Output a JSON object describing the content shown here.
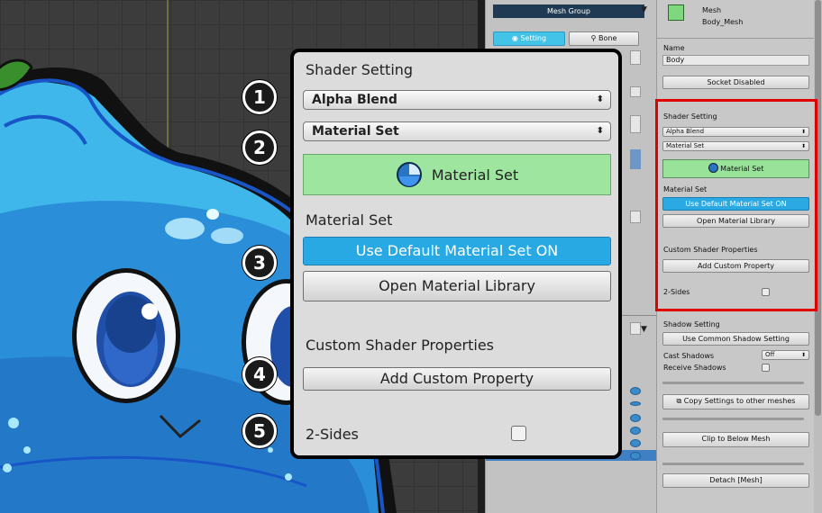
{
  "mid_panel": {
    "header": "Mesh Group",
    "tabs": [
      {
        "label": "Setting",
        "active": true
      },
      {
        "label": "Bone",
        "active": false
      }
    ]
  },
  "inspector": {
    "object_type": "Mesh",
    "object_name": "Body_Mesh",
    "name_label": "Name",
    "name_value": "Body",
    "socket_button": "Socket Disabled",
    "shader_setting_label": "Shader Setting",
    "blend_mode": "Alpha Blend",
    "material_select": "Material Set",
    "material_set_button": "Material Set",
    "material_set_label": "Material Set",
    "use_default_button": "Use Default Material Set ON",
    "open_library_button": "Open Material Library",
    "custom_props_label": "Custom Shader Properties",
    "add_custom_button": "Add Custom Property",
    "two_sides_label": "2-Sides",
    "shadow_setting_label": "Shadow Setting",
    "use_common_shadow_button": "Use Common Shadow Setting",
    "cast_shadows_label": "Cast Shadows",
    "cast_shadows_value": "Off",
    "receive_shadows_label": "Receive Shadows",
    "copy_settings_button": "Copy Settings to other meshes",
    "clip_button": "Clip to Below Mesh",
    "detach_button": "Detach [Mesh]"
  },
  "zoom": {
    "shader_setting_label": "Shader Setting",
    "blend_mode": "Alpha Blend",
    "material_select": "Material Set",
    "material_set_button": "Material Set",
    "material_set_label": "Material Set",
    "use_default_button": "Use Default Material Set ON",
    "open_library_button": "Open Material Library",
    "custom_props_label": "Custom Shader Properties",
    "add_custom_button": "Add Custom Property",
    "two_sides_label": "2-Sides"
  },
  "markers": [
    "1",
    "2",
    "3",
    "4",
    "5"
  ],
  "colors": {
    "highlight_box": "#e00000",
    "active_blue": "#28a9e4",
    "material_green": "#9ee6a0"
  }
}
